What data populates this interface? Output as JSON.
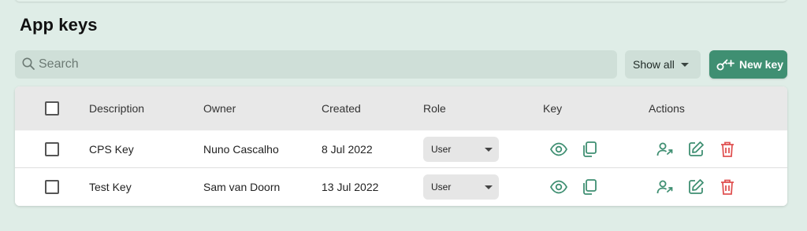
{
  "page": {
    "title": "App keys"
  },
  "search": {
    "placeholder": "Search",
    "value": ""
  },
  "filter": {
    "label": "Show all"
  },
  "new_key_button": {
    "label": "New key"
  },
  "table": {
    "columns": [
      "Description",
      "Owner",
      "Created",
      "Role",
      "Key",
      "Actions"
    ],
    "rows": [
      {
        "description": "CPS Key",
        "owner": "Nuno Cascalho",
        "created": "8 Jul 2022",
        "role": "User"
      },
      {
        "description": "Test Key",
        "owner": "Sam van Doorn",
        "created": "13 Jul 2022",
        "role": "User"
      }
    ]
  },
  "colors": {
    "background": "#dfede7",
    "accent": "#3f8f72",
    "danger": "#e05252",
    "field": "#cfdfd8"
  },
  "icons": {
    "search": "search-icon",
    "new_key": "key-plus-icon",
    "view": "eye-icon",
    "copy": "copy-icon",
    "transfer": "user-transfer-icon",
    "edit": "edit-icon",
    "delete": "trash-icon"
  }
}
